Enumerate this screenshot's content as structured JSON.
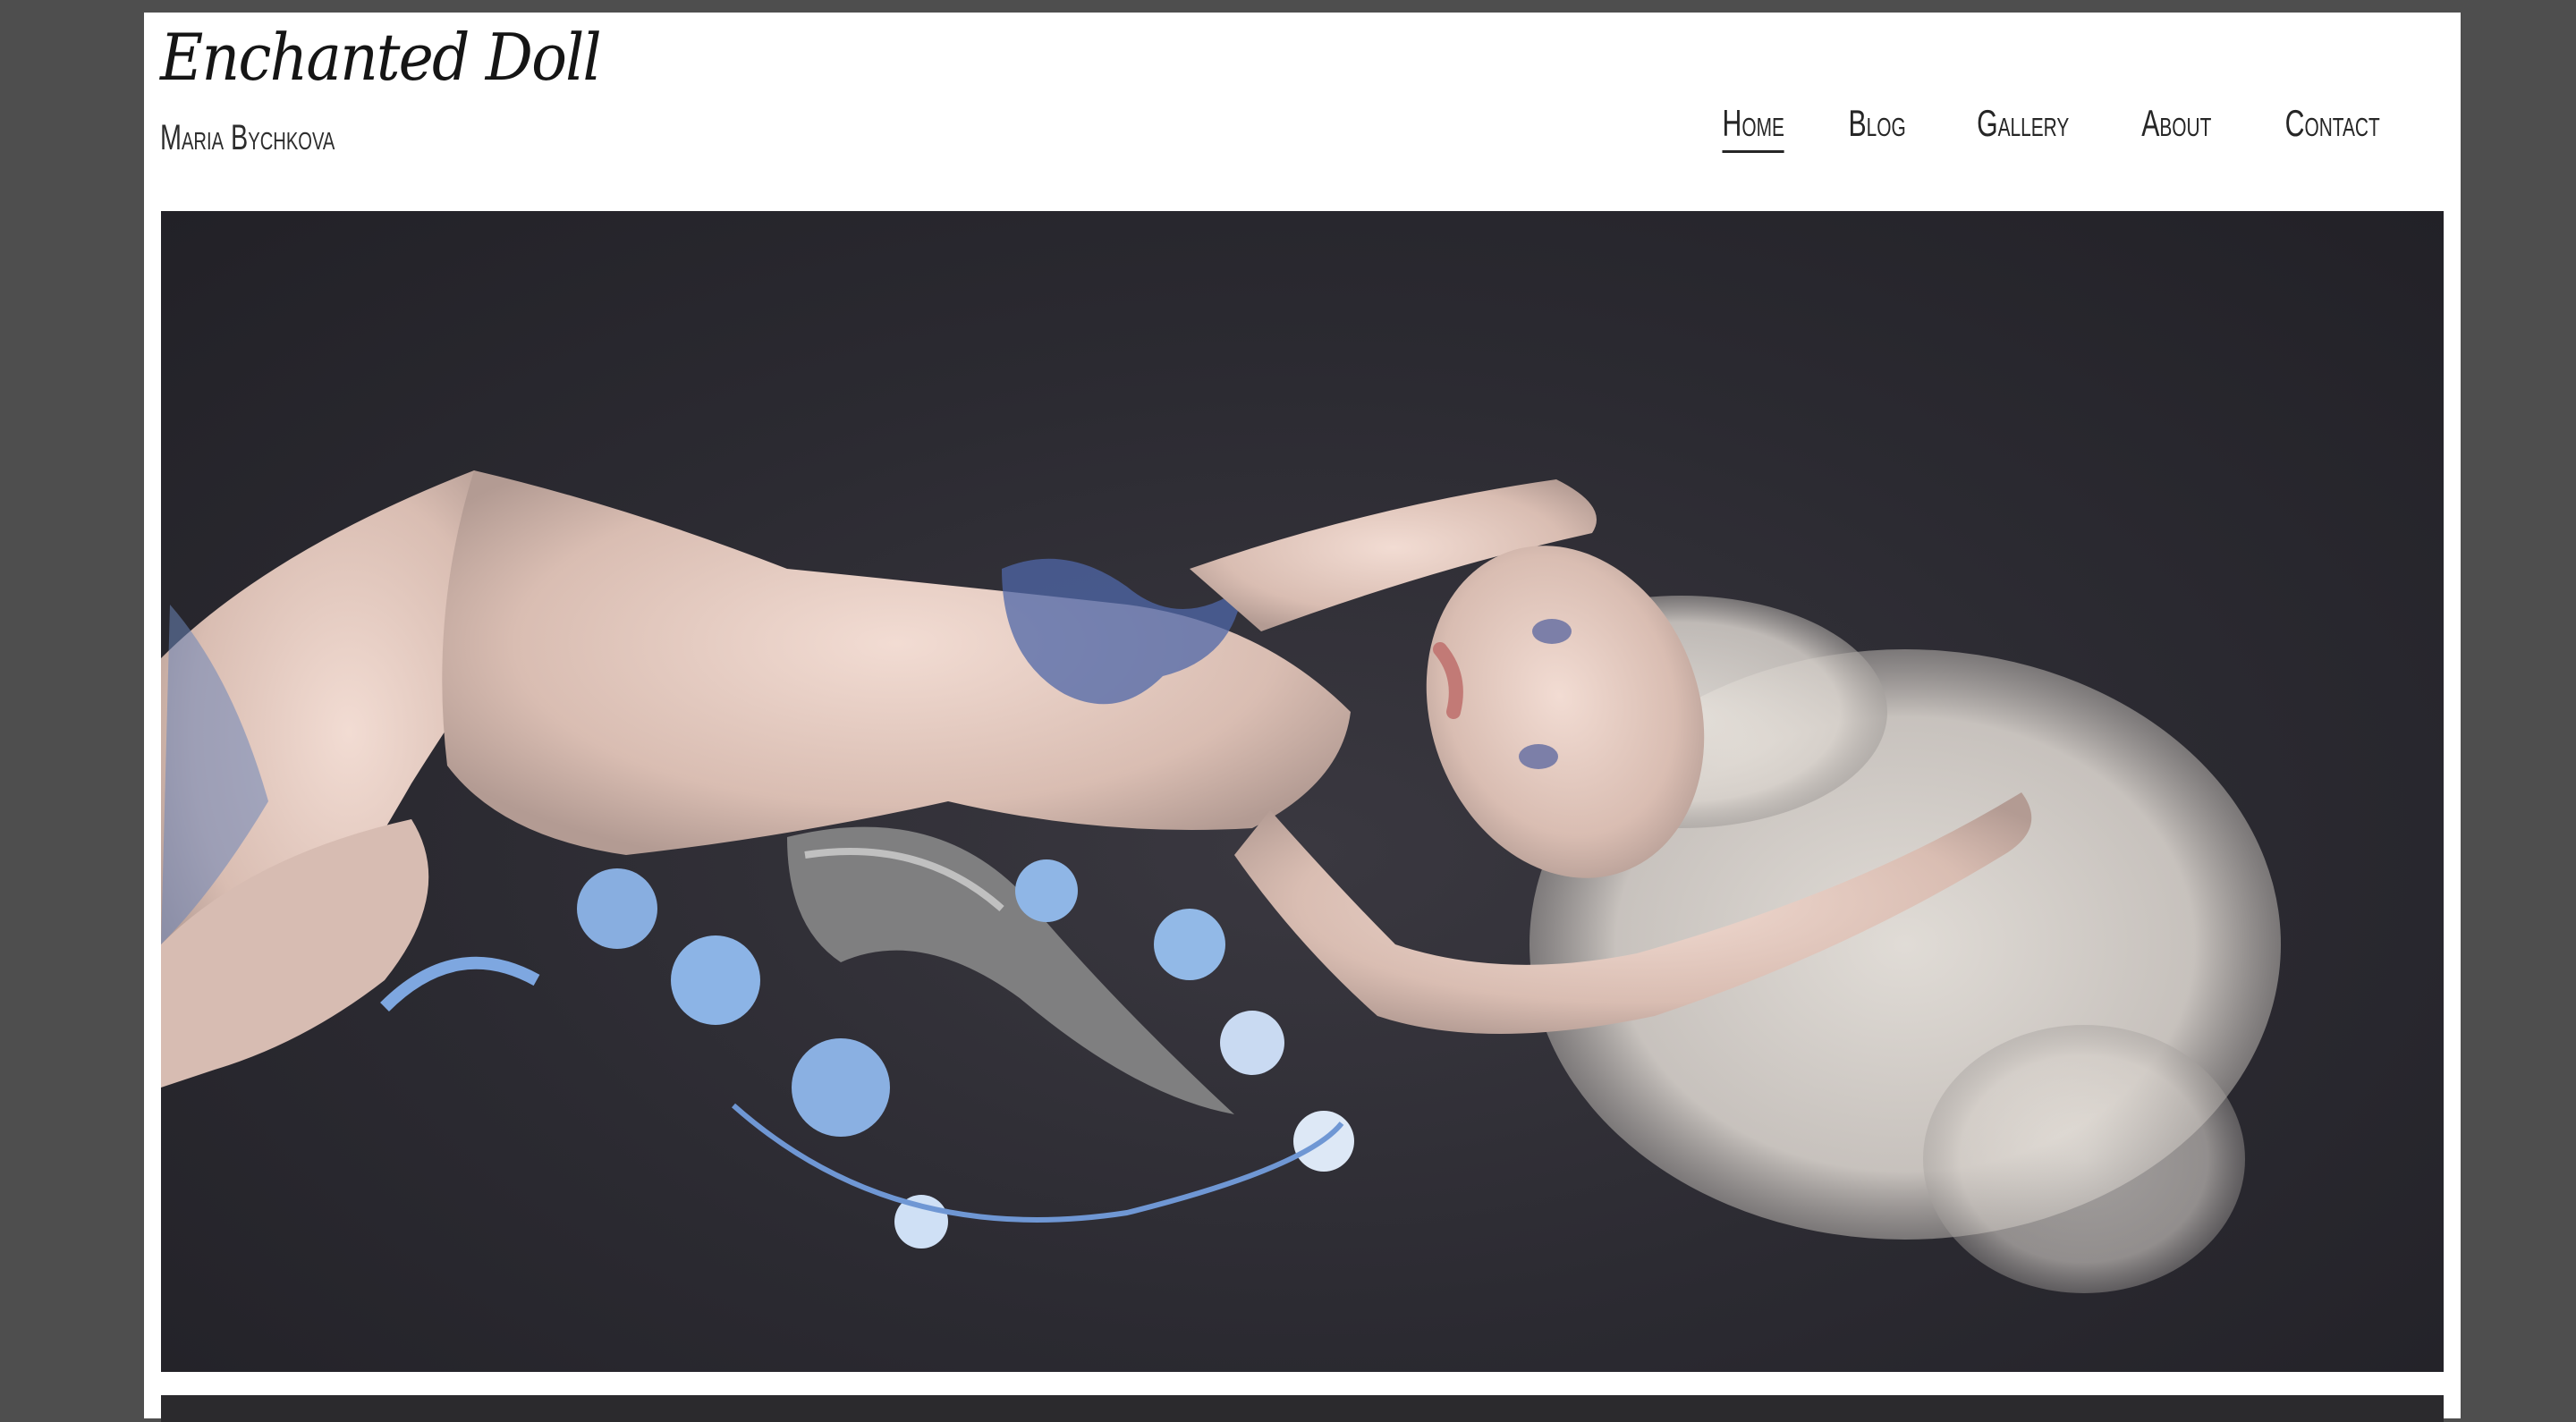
{
  "header": {
    "site_title": "Enchanted Doll",
    "site_subtitle": "Maria Bychkova"
  },
  "nav": {
    "items": [
      {
        "label": "Home",
        "active": true
      },
      {
        "label": "Blog",
        "active": false
      },
      {
        "label": "Gallery",
        "active": false
      },
      {
        "label": "About",
        "active": false
      },
      {
        "label": "Contact",
        "active": false
      }
    ]
  },
  "colors": {
    "window_frame": "#4e4e4e",
    "page_background": "#ffffff",
    "hero_background": "#2b2a31"
  }
}
